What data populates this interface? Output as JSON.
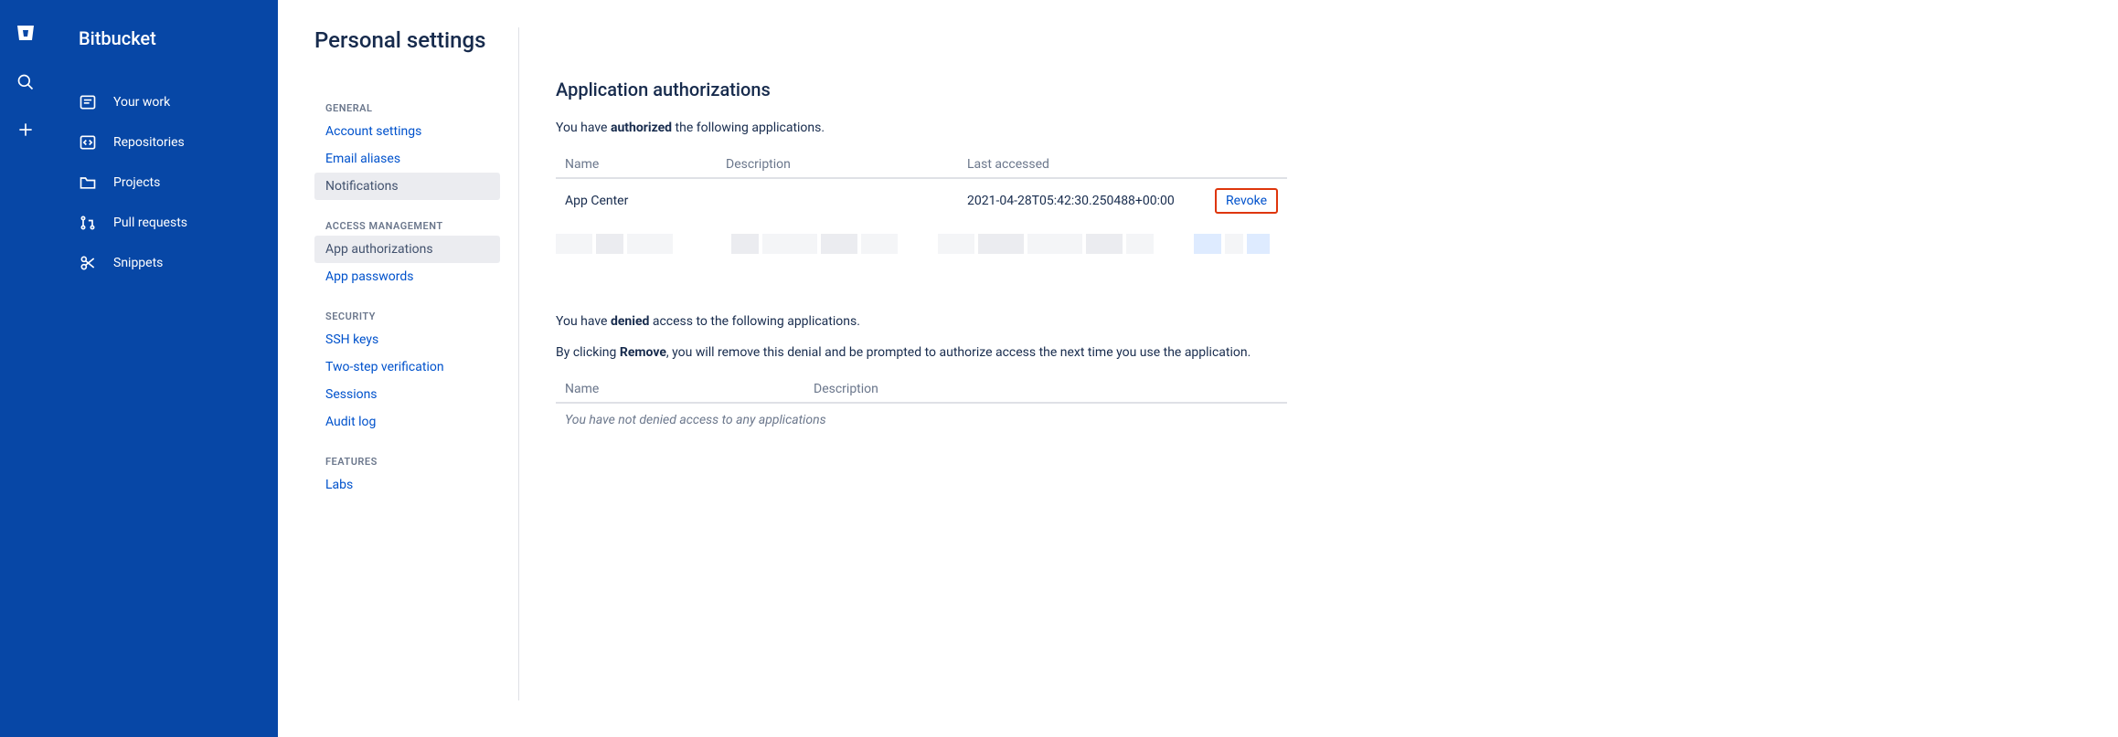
{
  "app": {
    "name": "Bitbucket"
  },
  "sidebar": {
    "items": [
      {
        "label": "Your work"
      },
      {
        "label": "Repositories"
      },
      {
        "label": "Projects"
      },
      {
        "label": "Pull requests"
      },
      {
        "label": "Snippets"
      }
    ]
  },
  "page": {
    "title": "Personal settings"
  },
  "settingsNav": {
    "groups": [
      {
        "header": "General",
        "items": [
          {
            "label": "Account settings",
            "active": false
          },
          {
            "label": "Email aliases",
            "active": false
          },
          {
            "label": "Notifications",
            "active": true
          }
        ]
      },
      {
        "header": "Access Management",
        "items": [
          {
            "label": "App authorizations",
            "active": true
          },
          {
            "label": "App passwords",
            "active": false
          }
        ]
      },
      {
        "header": "Security",
        "items": [
          {
            "label": "SSH keys",
            "active": false
          },
          {
            "label": "Two-step verification",
            "active": false
          },
          {
            "label": "Sessions",
            "active": false
          },
          {
            "label": "Audit log",
            "active": false
          }
        ]
      },
      {
        "header": "Features",
        "items": [
          {
            "label": "Labs",
            "active": false
          }
        ]
      }
    ]
  },
  "content": {
    "heading": "Application authorizations",
    "authorized_intro_pre": "You have ",
    "authorized_intro_strong": "authorized",
    "authorized_intro_post": " the following applications.",
    "authorized_table": {
      "headers": {
        "name": "Name",
        "description": "Description",
        "last_accessed": "Last accessed"
      },
      "rows": [
        {
          "name": "App Center",
          "description": "",
          "last_accessed": "2021-04-28T05:42:30.250488+00:00",
          "action": "Revoke"
        }
      ]
    },
    "denied_intro_pre": "You have ",
    "denied_intro_strong": "denied",
    "denied_intro_post": " access to the following applications.",
    "remove_note_pre": "By clicking ",
    "remove_note_strong": "Remove",
    "remove_note_post": ", you will remove this denial and be prompted to authorize access the next time you use the application.",
    "denied_table": {
      "headers": {
        "name": "Name",
        "description": "Description"
      },
      "empty": "You have not denied access to any applications"
    }
  }
}
